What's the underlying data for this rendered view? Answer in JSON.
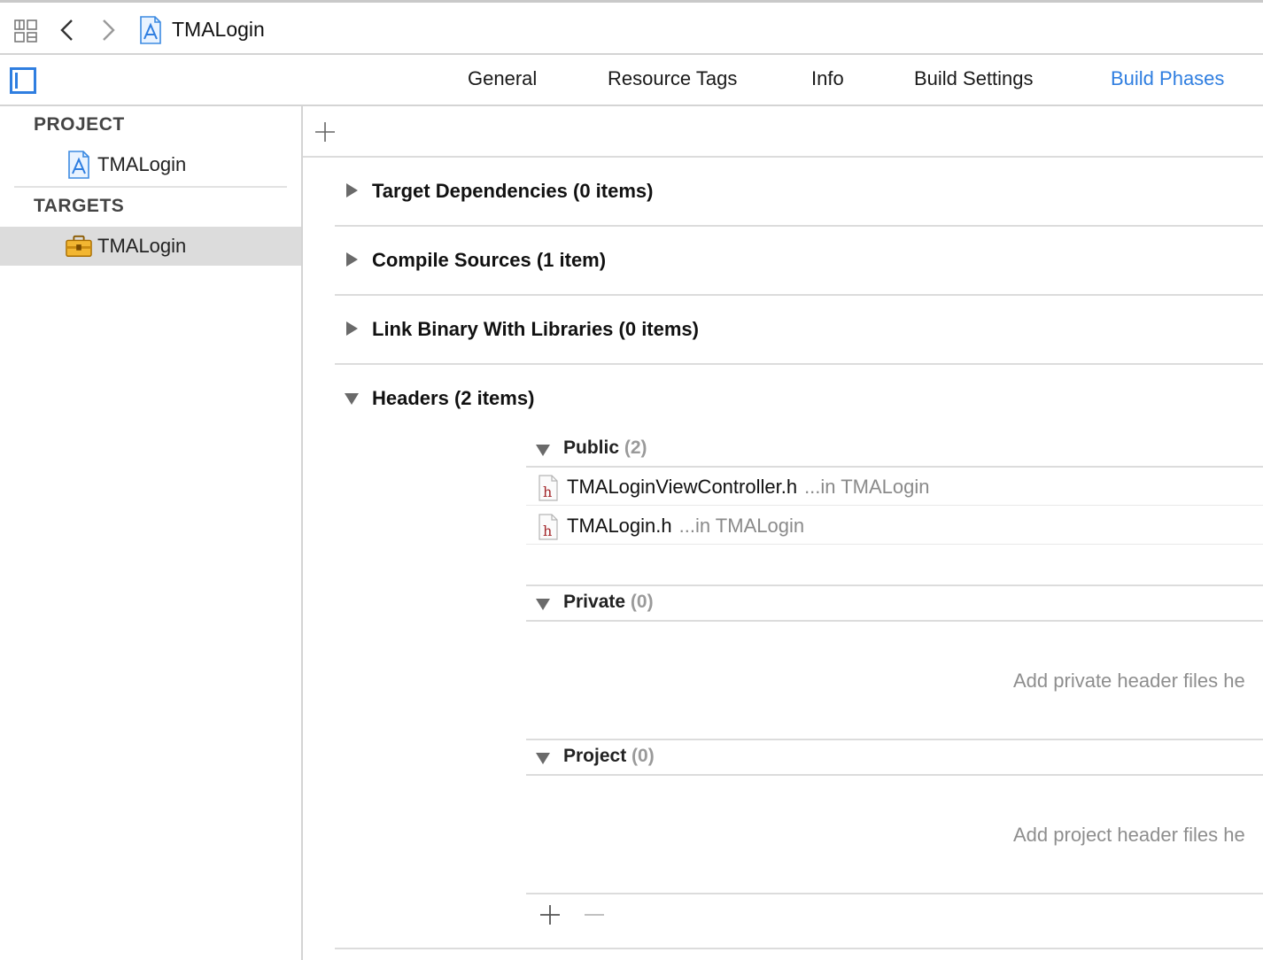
{
  "jumpbar": {
    "crumb": "TMALogin"
  },
  "tabs": [
    {
      "label": "General",
      "active": false
    },
    {
      "label": "Resource Tags",
      "active": false
    },
    {
      "label": "Info",
      "active": false
    },
    {
      "label": "Build Settings",
      "active": false
    },
    {
      "label": "Build Phases",
      "active": true
    }
  ],
  "navigator": {
    "project_header": "PROJECT",
    "project_item": "TMALogin",
    "targets_header": "TARGETS",
    "target_item": "TMALogin"
  },
  "phases": {
    "target_dependencies": "Target Dependencies (0 items)",
    "compile_sources": "Compile Sources (1 item)",
    "link_binary": "Link Binary With Libraries (0 items)",
    "headers": "Headers (2 items)"
  },
  "headers": {
    "public": {
      "title": "Public",
      "count": "(2)"
    },
    "files": [
      {
        "name": "TMALoginViewController.h",
        "location": "...in TMALogin"
      },
      {
        "name": "TMALogin.h",
        "location": "...in TMALogin"
      }
    ],
    "private": {
      "title": "Private",
      "count": "(0)",
      "placeholder": "Add private header files he"
    },
    "project": {
      "title": "Project",
      "count": "(0)",
      "placeholder": "Add project header files he"
    }
  },
  "colors": {
    "accent": "#2f7ee0",
    "selection": "#dcdcdc",
    "separator": "#dcdcdc",
    "secondary_text": "#8a8a8a"
  },
  "icons": {
    "related_items": "grid-icon",
    "back": "chevron-left-icon",
    "forward": "chevron-right-icon",
    "project": "xcode-project-icon",
    "target": "toolbox-icon",
    "header_file": "header-file-icon",
    "add": "plus-icon",
    "remove": "minus-icon",
    "sidebar": "sidebar-toggle-icon",
    "disclosure_closed": "disclosure-right-icon",
    "disclosure_open": "disclosure-down-icon"
  }
}
